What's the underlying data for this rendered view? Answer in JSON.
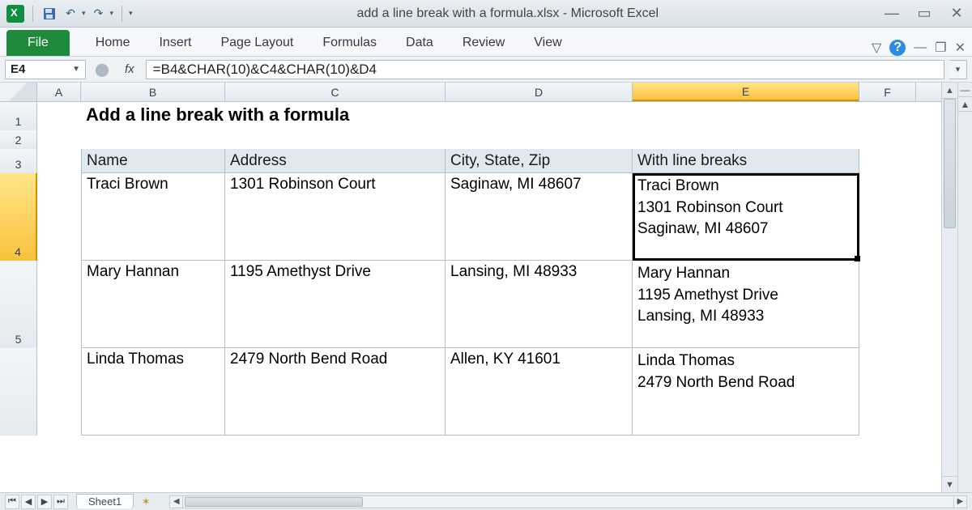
{
  "window": {
    "title": "add a line break with a formula.xlsx  -  Microsoft Excel"
  },
  "ribbon": {
    "file": "File",
    "tabs": [
      "Home",
      "Insert",
      "Page Layout",
      "Formulas",
      "Data",
      "Review",
      "View"
    ]
  },
  "formula_bar": {
    "name_box": "E4",
    "fx_label": "fx",
    "formula": "=B4&CHAR(10)&C4&CHAR(10)&D4"
  },
  "columns": [
    "A",
    "B",
    "C",
    "D",
    "E",
    "F"
  ],
  "selected_column": "E",
  "row_numbers": [
    "1",
    "2",
    "3",
    "4",
    "5"
  ],
  "selected_row": "4",
  "title_cell": "Add a line break with a formula",
  "headers": {
    "name": "Name",
    "address": "Address",
    "city": "City, State, Zip",
    "with": "With line breaks"
  },
  "data": [
    {
      "name": "Traci Brown",
      "address": "1301 Robinson Court",
      "city": "Saginaw, MI 48607",
      "with": "Traci Brown\n1301 Robinson Court\nSaginaw, MI 48607"
    },
    {
      "name": "Mary Hannan",
      "address": "1195 Amethyst Drive",
      "city": "Lansing, MI 48933",
      "with": "Mary Hannan\n1195 Amethyst Drive\nLansing, MI 48933"
    },
    {
      "name": "Linda Thomas",
      "address": "2479 North Bend Road",
      "city": "Allen, KY 41601",
      "with": "Linda Thomas\n2479 North Bend Road"
    }
  ],
  "sheet_tab": "Sheet1"
}
